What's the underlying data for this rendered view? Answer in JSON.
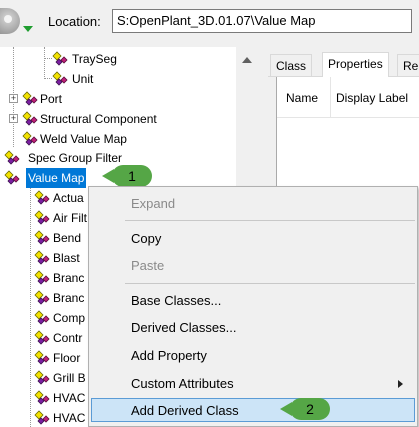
{
  "toolbar": {
    "location_label": "Location:",
    "location_value": "S:OpenPlant_3D.01.07\\Value Map"
  },
  "tree": {
    "items": [
      {
        "label": "TraySeg"
      },
      {
        "label": "Unit"
      },
      {
        "label": "Port"
      },
      {
        "label": "Structural Component"
      },
      {
        "label": "Weld Value Map"
      },
      {
        "label": "Spec Group Filter"
      },
      {
        "label": "Value Map"
      },
      {
        "label": "Actua"
      },
      {
        "label": "Air Filt"
      },
      {
        "label": "Bend"
      },
      {
        "label": "Blast"
      },
      {
        "label": "Branc"
      },
      {
        "label": "Branc"
      },
      {
        "label": "Comp"
      },
      {
        "label": "Contr"
      },
      {
        "label": "Floor"
      },
      {
        "label": "Grill B"
      },
      {
        "label": "HVAC"
      },
      {
        "label": "HVAC"
      }
    ]
  },
  "right_panel": {
    "tabs": [
      {
        "label": "Class"
      },
      {
        "label": "Properties"
      },
      {
        "label": "Re"
      }
    ],
    "columns": [
      {
        "label": "Name"
      },
      {
        "label": "Display Label"
      }
    ]
  },
  "context_menu": {
    "items": [
      {
        "label": "Expand",
        "enabled": false
      },
      {
        "label": "Copy",
        "enabled": true
      },
      {
        "label": "Paste",
        "enabled": false
      },
      {
        "label": "Base Classes...",
        "enabled": true
      },
      {
        "label": "Derived Classes...",
        "enabled": true
      },
      {
        "label": "Add Property",
        "enabled": true
      },
      {
        "label": "Custom Attributes",
        "enabled": true,
        "submenu": true
      },
      {
        "label": "Add Derived Class",
        "enabled": true,
        "highlighted": true
      }
    ]
  },
  "callouts": [
    {
      "label": "1"
    },
    {
      "label": "2"
    }
  ],
  "colors": {
    "selection": "#0078d7",
    "callout": "#55a646",
    "menu_highlight": "#cce4f7"
  }
}
